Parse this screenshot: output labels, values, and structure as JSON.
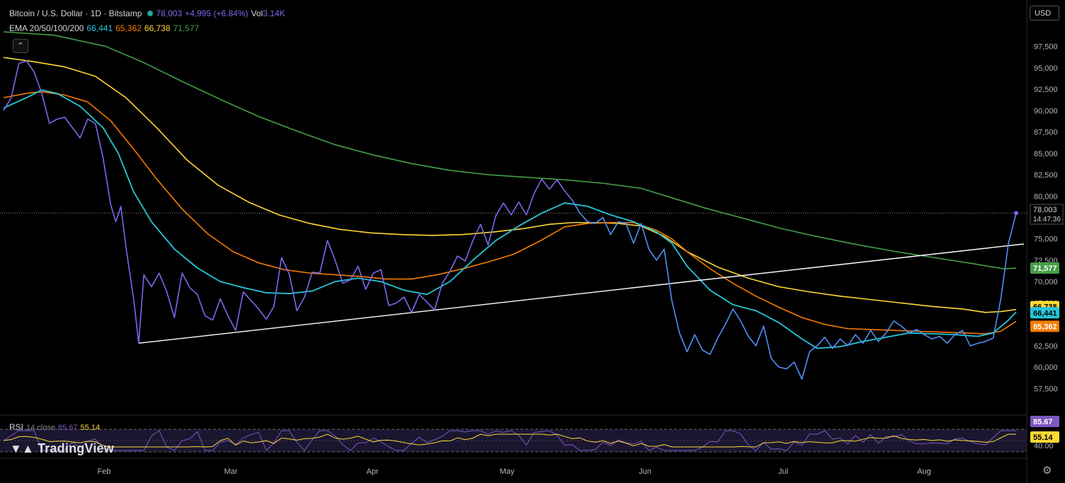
{
  "header": {
    "symbol": "Bitcoin / U.S. Dollar · 1D · Bitstamp",
    "price": "78,003",
    "change": "+4,995 (+6.84%)",
    "vol_label": "Vol",
    "vol_value": "3.14K",
    "currency": "USD",
    "collapse_icon": "chevron-up-icon"
  },
  "ema_legend": {
    "label": "EMA 20/50/100/200",
    "v20": "66,441",
    "v50": "65,362",
    "v100": "66,738",
    "v200": "71,577"
  },
  "rsi_legend": {
    "label": "RSI",
    "params": "14 close",
    "v1": "85.67",
    "v2": "55.14"
  },
  "watermark": "TradingView",
  "colors": {
    "price": "#7b68ee",
    "ema20": "#26c6da",
    "ema50": "#f57c00",
    "ema100": "#fdd835",
    "ema200": "#43a047",
    "trendline": "#ffffff",
    "rsi": "#7e57c2",
    "rsi_ma": "#fdd835"
  },
  "chart_data": {
    "type": "line",
    "y_axis_ticks": [
      "97,500",
      "95,000",
      "92,500",
      "90,000",
      "87,500",
      "85,000",
      "82,500",
      "80,000",
      "75,000",
      "72,500",
      "70,000",
      "67,500",
      "62,500",
      "60,000",
      "57,500"
    ],
    "ylim": [
      55800,
      99200
    ],
    "x_axis_ticks": [
      "Feb",
      "Mar",
      "Apr",
      "May",
      "Jun",
      "Jul",
      "Aug"
    ],
    "xlim": [
      0,
      235
    ],
    "last_price_label": "78,003",
    "countdown": "14:47:36",
    "series": [
      {
        "id": "price",
        "values": [
          [
            0,
            90000
          ],
          [
            3,
            91500
          ],
          [
            6,
            95500
          ],
          [
            9,
            95800
          ],
          [
            12,
            94500
          ],
          [
            15,
            92000
          ],
          [
            18,
            88500
          ],
          [
            21,
            89000
          ],
          [
            24,
            89200
          ],
          [
            27,
            88000
          ],
          [
            30,
            86800
          ],
          [
            33,
            89000
          ],
          [
            36,
            88500
          ],
          [
            39,
            84500
          ],
          [
            42,
            79000
          ],
          [
            44,
            77000
          ],
          [
            46,
            78800
          ],
          [
            48,
            74000
          ],
          [
            51,
            68000
          ],
          [
            53,
            62800
          ],
          [
            55,
            70800
          ],
          [
            58,
            69400
          ],
          [
            61,
            71000
          ],
          [
            64,
            68800
          ],
          [
            67,
            65800
          ],
          [
            70,
            71000
          ],
          [
            73,
            69300
          ],
          [
            76,
            68500
          ],
          [
            79,
            66000
          ],
          [
            82,
            65500
          ],
          [
            85,
            68000
          ],
          [
            88,
            66000
          ],
          [
            91,
            64300
          ],
          [
            94,
            68800
          ],
          [
            97,
            67800
          ],
          [
            100,
            66800
          ],
          [
            103,
            65600
          ],
          [
            106,
            67100
          ],
          [
            109,
            72800
          ],
          [
            112,
            70900
          ],
          [
            115,
            66600
          ],
          [
            118,
            68200
          ],
          [
            121,
            71100
          ],
          [
            124,
            71000
          ],
          [
            127,
            74800
          ],
          [
            130,
            72500
          ],
          [
            133,
            69800
          ],
          [
            136,
            70200
          ],
          [
            139,
            71800
          ],
          [
            142,
            69100
          ],
          [
            145,
            71000
          ],
          [
            148,
            71400
          ],
          [
            151,
            67200
          ],
          [
            154,
            67500
          ],
          [
            157,
            68200
          ],
          [
            160,
            66400
          ],
          [
            163,
            68500
          ],
          [
            166,
            67600
          ],
          [
            169,
            66700
          ],
          [
            172,
            69800
          ],
          [
            175,
            71200
          ],
          [
            178,
            73000
          ],
          [
            181,
            72400
          ],
          [
            184,
            74800
          ],
          [
            187,
            76700
          ],
          [
            190,
            74300
          ],
          [
            193,
            77700
          ],
          [
            196,
            79200
          ],
          [
            199,
            77800
          ],
          [
            202,
            79300
          ],
          [
            205,
            77800
          ],
          [
            208,
            80300
          ],
          [
            211,
            82000
          ],
          [
            214,
            80800
          ],
          [
            217,
            81900
          ],
          [
            220,
            80600
          ],
          [
            223,
            79500
          ]
        ]
      },
      {
        "id": "price_b",
        "values": [
          [
            223,
            79500
          ],
          [
            226,
            78000
          ],
          [
            229,
            77000
          ],
          [
            232,
            76800
          ],
          [
            235,
            77500
          ],
          [
            238,
            75500
          ],
          [
            241,
            77000
          ],
          [
            244,
            76800
          ],
          [
            247,
            74500
          ],
          [
            250,
            76800
          ],
          [
            253,
            73800
          ],
          [
            256,
            72500
          ],
          [
            259,
            73800
          ],
          [
            262,
            67800
          ],
          [
            265,
            64000
          ],
          [
            268,
            61800
          ],
          [
            271,
            63800
          ],
          [
            274,
            62000
          ],
          [
            277,
            61500
          ],
          [
            280,
            63400
          ],
          [
            283,
            65000
          ],
          [
            286,
            66800
          ],
          [
            289,
            65400
          ],
          [
            292,
            63600
          ],
          [
            295,
            62500
          ],
          [
            298,
            64800
          ],
          [
            301,
            61000
          ],
          [
            304,
            60000
          ],
          [
            307,
            59800
          ],
          [
            310,
            60600
          ],
          [
            313,
            58600
          ],
          [
            316,
            61800
          ],
          [
            319,
            62500
          ],
          [
            322,
            63500
          ],
          [
            325,
            62200
          ],
          [
            328,
            63300
          ],
          [
            331,
            62500
          ],
          [
            334,
            63800
          ],
          [
            337,
            62800
          ],
          [
            340,
            64300
          ],
          [
            343,
            63000
          ],
          [
            346,
            64000
          ],
          [
            349,
            65400
          ],
          [
            352,
            64800
          ],
          [
            355,
            64000
          ],
          [
            358,
            64400
          ],
          [
            361,
            63800
          ],
          [
            364,
            63300
          ],
          [
            367,
            63600
          ],
          [
            370,
            62800
          ],
          [
            373,
            63800
          ],
          [
            376,
            64300
          ],
          [
            379,
            62500
          ],
          [
            382,
            62800
          ],
          [
            385,
            63000
          ],
          [
            388,
            63400
          ],
          [
            391,
            68000
          ],
          [
            394,
            74500
          ],
          [
            397,
            78003
          ]
        ]
      },
      {
        "id": "ema20",
        "values": [
          [
            0,
            90300
          ],
          [
            9,
            91500
          ],
          [
            15,
            92400
          ],
          [
            21,
            92000
          ],
          [
            30,
            90500
          ],
          [
            39,
            88000
          ],
          [
            45,
            85000
          ],
          [
            51,
            80500
          ],
          [
            58,
            77000
          ],
          [
            67,
            73800
          ],
          [
            76,
            71600
          ],
          [
            85,
            70000
          ],
          [
            94,
            69300
          ],
          [
            103,
            68700
          ],
          [
            112,
            68600
          ],
          [
            121,
            68900
          ],
          [
            130,
            70000
          ],
          [
            139,
            70400
          ],
          [
            148,
            70000
          ],
          [
            157,
            69000
          ],
          [
            166,
            68500
          ],
          [
            175,
            70000
          ],
          [
            184,
            72500
          ],
          [
            193,
            74800
          ],
          [
            202,
            76500
          ],
          [
            211,
            78000
          ],
          [
            220,
            79200
          ],
          [
            229,
            78800
          ],
          [
            238,
            77800
          ],
          [
            247,
            77000
          ],
          [
            256,
            75800
          ],
          [
            262,
            74500
          ],
          [
            268,
            71800
          ],
          [
            277,
            69000
          ],
          [
            286,
            67300
          ],
          [
            295,
            66600
          ],
          [
            304,
            65200
          ],
          [
            313,
            63300
          ],
          [
            319,
            62200
          ],
          [
            328,
            62400
          ],
          [
            337,
            63000
          ],
          [
            346,
            63500
          ],
          [
            355,
            64000
          ],
          [
            364,
            63900
          ],
          [
            373,
            63800
          ],
          [
            382,
            63600
          ],
          [
            388,
            64000
          ],
          [
            394,
            65500
          ],
          [
            397,
            66441
          ]
        ]
      },
      {
        "id": "ema50",
        "values": [
          [
            0,
            91500
          ],
          [
            9,
            92000
          ],
          [
            15,
            92200
          ],
          [
            24,
            91800
          ],
          [
            33,
            91000
          ],
          [
            42,
            88800
          ],
          [
            51,
            85500
          ],
          [
            60,
            82000
          ],
          [
            70,
            78500
          ],
          [
            80,
            75600
          ],
          [
            90,
            73500
          ],
          [
            100,
            72200
          ],
          [
            110,
            71400
          ],
          [
            120,
            71000
          ],
          [
            130,
            70800
          ],
          [
            140,
            70600
          ],
          [
            150,
            70300
          ],
          [
            160,
            70300
          ],
          [
            170,
            70800
          ],
          [
            180,
            71500
          ],
          [
            190,
            72300
          ],
          [
            200,
            73200
          ],
          [
            210,
            74700
          ],
          [
            220,
            76400
          ],
          [
            229,
            76800
          ],
          [
            238,
            76900
          ],
          [
            247,
            76900
          ],
          [
            256,
            76000
          ],
          [
            262,
            75000
          ],
          [
            268,
            73500
          ],
          [
            277,
            71500
          ],
          [
            286,
            69800
          ],
          [
            295,
            68300
          ],
          [
            304,
            67000
          ],
          [
            313,
            65800
          ],
          [
            322,
            65000
          ],
          [
            331,
            64500
          ],
          [
            340,
            64400
          ],
          [
            349,
            64300
          ],
          [
            358,
            64200
          ],
          [
            367,
            64100
          ],
          [
            376,
            64000
          ],
          [
            385,
            63900
          ],
          [
            391,
            64200
          ],
          [
            397,
            65362
          ]
        ]
      },
      {
        "id": "ema100",
        "values": [
          [
            0,
            96200
          ],
          [
            12,
            95700
          ],
          [
            24,
            95100
          ],
          [
            36,
            94000
          ],
          [
            48,
            91500
          ],
          [
            60,
            88000
          ],
          [
            72,
            84200
          ],
          [
            84,
            81300
          ],
          [
            96,
            79300
          ],
          [
            108,
            77800
          ],
          [
            120,
            76800
          ],
          [
            132,
            76100
          ],
          [
            144,
            75700
          ],
          [
            156,
            75500
          ],
          [
            168,
            75400
          ],
          [
            180,
            75500
          ],
          [
            192,
            75800
          ],
          [
            204,
            76200
          ],
          [
            214,
            76700
          ],
          [
            223,
            76900
          ],
          [
            232,
            76900
          ],
          [
            241,
            76800
          ],
          [
            250,
            76500
          ],
          [
            259,
            75300
          ],
          [
            268,
            73500
          ],
          [
            280,
            71700
          ],
          [
            292,
            70400
          ],
          [
            304,
            69400
          ],
          [
            316,
            68800
          ],
          [
            328,
            68300
          ],
          [
            340,
            67900
          ],
          [
            352,
            67500
          ],
          [
            364,
            67100
          ],
          [
            376,
            66800
          ],
          [
            385,
            66400
          ],
          [
            391,
            66500
          ],
          [
            397,
            66738
          ]
        ]
      },
      {
        "id": "ema200",
        "values": [
          [
            0,
            99200
          ],
          [
            20,
            98800
          ],
          [
            40,
            97500
          ],
          [
            55,
            95600
          ],
          [
            70,
            93400
          ],
          [
            85,
            91300
          ],
          [
            100,
            89300
          ],
          [
            115,
            87600
          ],
          [
            130,
            86000
          ],
          [
            145,
            84800
          ],
          [
            160,
            83800
          ],
          [
            175,
            83000
          ],
          [
            190,
            82500
          ],
          [
            205,
            82200
          ],
          [
            220,
            81900
          ],
          [
            235,
            81500
          ],
          [
            250,
            80900
          ],
          [
            262,
            79800
          ],
          [
            275,
            78600
          ],
          [
            290,
            77400
          ],
          [
            305,
            76200
          ],
          [
            320,
            75200
          ],
          [
            335,
            74300
          ],
          [
            350,
            73500
          ],
          [
            365,
            72800
          ],
          [
            380,
            72100
          ],
          [
            392,
            71500
          ],
          [
            397,
            71577
          ]
        ]
      },
      {
        "id": "trendline",
        "values": [
          [
            53,
            62800
          ],
          [
            400,
            74400
          ]
        ]
      }
    ]
  }
}
